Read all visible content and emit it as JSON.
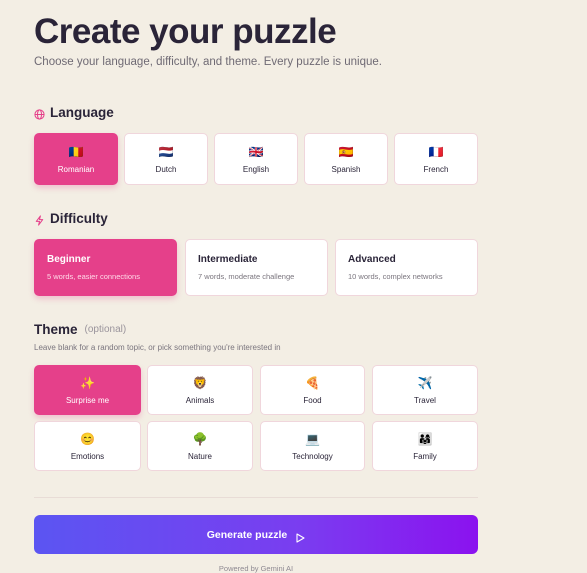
{
  "header": {
    "title": "Create your puzzle",
    "subtitle": "Choose your language, difficulty, and theme. Every puzzle is unique."
  },
  "language": {
    "heading": "Language",
    "icon": "globe-icon",
    "selected": "Romanian",
    "options": [
      {
        "label": "Romanian",
        "emoji": "🇷🇴",
        "selected": true
      },
      {
        "label": "Dutch",
        "emoji": "🇳🇱",
        "selected": false
      },
      {
        "label": "English",
        "emoji": "🇬🇧",
        "selected": false
      },
      {
        "label": "Spanish",
        "emoji": "🇪🇸",
        "selected": false
      },
      {
        "label": "French",
        "emoji": "🇫🇷",
        "selected": false
      }
    ]
  },
  "difficulty": {
    "heading": "Difficulty",
    "icon": "lightning-icon",
    "selected": "Beginner",
    "options": [
      {
        "title": "Beginner",
        "description": "5 words, easier connections",
        "selected": true
      },
      {
        "title": "Intermediate",
        "description": "7 words, moderate challenge",
        "selected": false
      },
      {
        "title": "Advanced",
        "description": "10 words, complex networks",
        "selected": false
      }
    ]
  },
  "theme": {
    "heading": "Theme",
    "optional_label": "(optional)",
    "hint": "Leave blank for a random topic, or pick something you're interested in",
    "selected": "Surprise me",
    "options": [
      {
        "label": "Surprise me",
        "emoji": "✨",
        "selected": true
      },
      {
        "label": "Animals",
        "emoji": "🦁",
        "selected": false
      },
      {
        "label": "Food",
        "emoji": "🍕",
        "selected": false
      },
      {
        "label": "Travel",
        "emoji": "✈️",
        "selected": false
      },
      {
        "label": "Emotions",
        "emoji": "😊",
        "selected": false
      },
      {
        "label": "Nature",
        "emoji": "🌳",
        "selected": false
      },
      {
        "label": "Technology",
        "emoji": "💻",
        "selected": false
      },
      {
        "label": "Family",
        "emoji": "👨‍👩‍👧",
        "selected": false
      }
    ]
  },
  "actions": {
    "generate_label": "Generate puzzle",
    "generate_icon": "play-icon"
  },
  "footer": {
    "text": "Powered by Gemini AI"
  },
  "colors": {
    "background": "#f3eee4",
    "accent": "#e5408a",
    "button_gradient_start": "#5b55f2",
    "button_gradient_end": "#8b12ef",
    "card_border": "#f0d6dc"
  }
}
